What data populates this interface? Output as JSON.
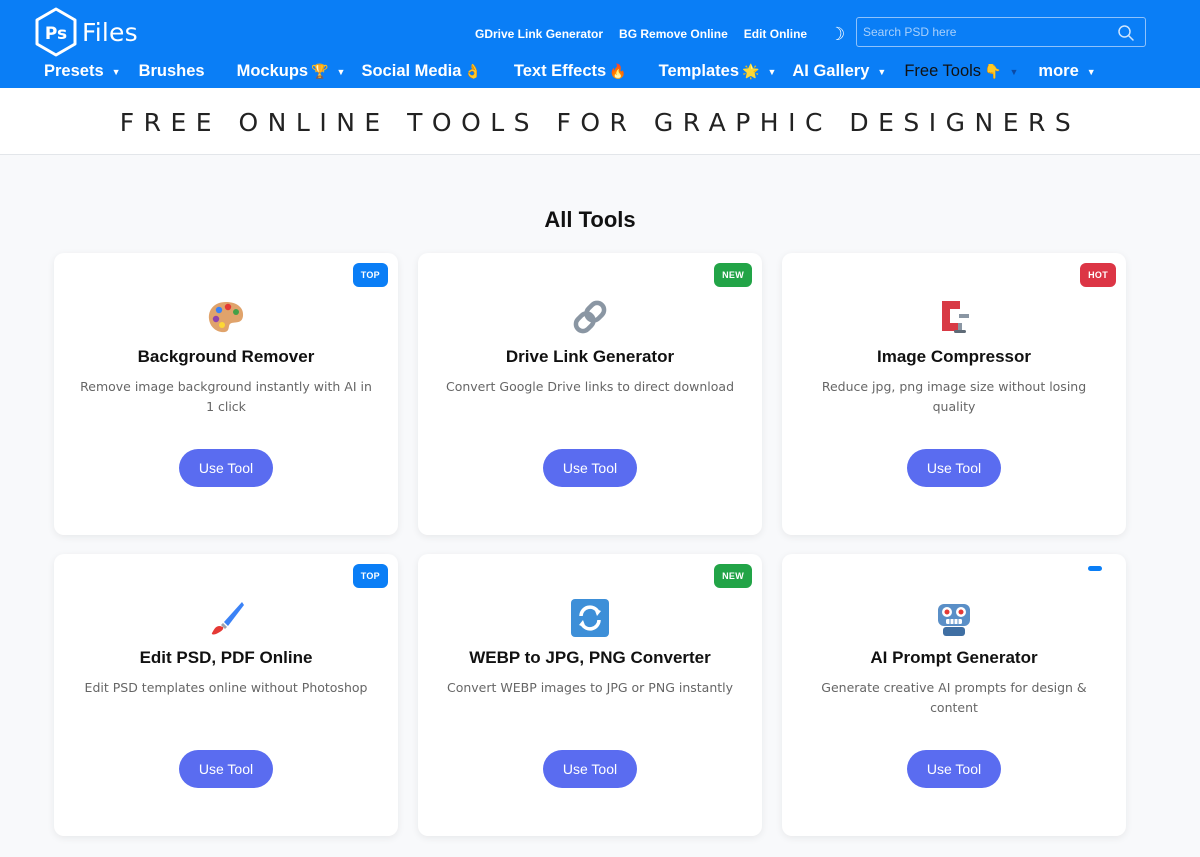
{
  "brand": {
    "logo_mark": "Ps",
    "name": "Files"
  },
  "header": {
    "top_links": [
      "GDrive Link Generator",
      "BG Remove Online",
      "Edit Online"
    ],
    "theme_toggle_glyph": "☽",
    "search": {
      "placeholder": "Search PSD here",
      "value": ""
    },
    "bg_color": "#0a7ef6"
  },
  "nav": {
    "items": [
      {
        "label": "Presets",
        "emoji": "",
        "caret": true,
        "dark": false
      },
      {
        "label": "Brushes",
        "emoji": "",
        "caret": false,
        "dark": false
      },
      {
        "label": "Mockups",
        "emoji": "🏆",
        "caret": true,
        "dark": false
      },
      {
        "label": "Social Media",
        "emoji": "👌",
        "caret": false,
        "dark": false
      },
      {
        "label": "Text Effects",
        "emoji": "🔥",
        "caret": false,
        "dark": false
      },
      {
        "label": "Templates",
        "emoji": "🌟",
        "caret": true,
        "dark": false
      },
      {
        "label": "AI Gallery",
        "emoji": "",
        "caret": true,
        "dark": false
      },
      {
        "label": "Free Tools",
        "emoji": "👇",
        "caret": true,
        "dark": true
      },
      {
        "label": "more",
        "emoji": "",
        "caret": true,
        "dark": false
      }
    ]
  },
  "banner": {
    "title": "FREE ONLINE TOOLS FOR GRAPHIC DESIGNERS"
  },
  "section": {
    "title": "All Tools"
  },
  "tools": [
    {
      "title": "Background Remover",
      "desc": "Remove image background instantly with AI in 1 click",
      "badge": "TOP",
      "badge_type": "top",
      "icon": "palette-icon",
      "button": "Use Tool"
    },
    {
      "title": "Drive Link Generator",
      "desc": "Convert Google Drive links to direct download",
      "badge": "NEW",
      "badge_type": "new",
      "icon": "link-icon",
      "button": "Use Tool"
    },
    {
      "title": "Image Compressor",
      "desc": "Reduce jpg, png image size without losing quality",
      "badge": "HOT",
      "badge_type": "hot",
      "icon": "clamp-icon",
      "button": "Use Tool"
    },
    {
      "title": "Edit PSD, PDF Online",
      "desc": "Edit PSD templates online without Photoshop",
      "badge": "TOP",
      "badge_type": "top",
      "icon": "paintbrush-icon",
      "button": "Use Tool"
    },
    {
      "title": "WEBP to JPG, PNG Converter",
      "desc": "Convert WEBP images to JPG or PNG instantly",
      "badge": "NEW",
      "badge_type": "new",
      "icon": "convert-arrows-icon",
      "button": "Use Tool"
    },
    {
      "title": "AI Prompt Generator",
      "desc": "Generate creative AI prompts for design & content",
      "badge": "",
      "badge_type": "bar",
      "icon": "robot-icon",
      "button": "Use Tool"
    }
  ],
  "colors": {
    "primary": "#0a7ef6",
    "button": "#5a6cf0",
    "new": "#22a447",
    "hot": "#dc3545"
  }
}
